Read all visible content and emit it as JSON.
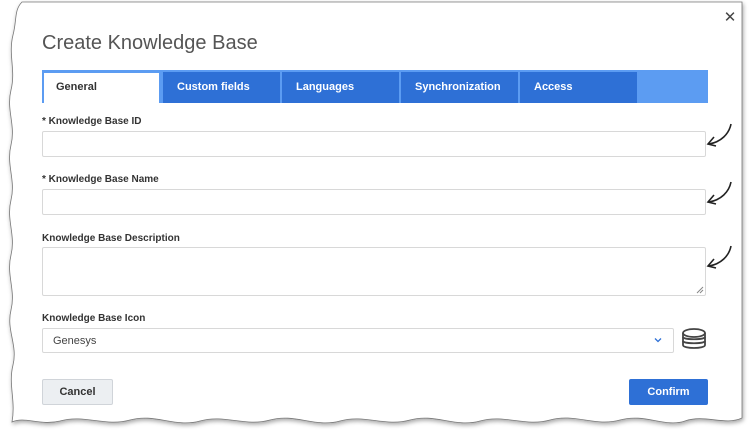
{
  "dialog": {
    "title": "Create Knowledge Base",
    "close_icon": "close-icon"
  },
  "tabs": [
    {
      "label": "General",
      "active": true
    },
    {
      "label": "Custom fields",
      "active": false
    },
    {
      "label": "Languages",
      "active": false
    },
    {
      "label": "Synchronization",
      "active": false
    },
    {
      "label": "Access",
      "active": false
    }
  ],
  "fields": {
    "kb_id": {
      "label": "* Knowledge Base ID",
      "value": ""
    },
    "kb_name": {
      "label": "* Knowledge Base Name",
      "value": ""
    },
    "kb_description": {
      "label": "Knowledge Base Description",
      "value": ""
    },
    "kb_icon": {
      "label": "Knowledge Base Icon",
      "value": "Genesys",
      "icon": "database-stack-icon"
    }
  },
  "buttons": {
    "cancel": "Cancel",
    "confirm": "Confirm"
  },
  "colors": {
    "tab_bar": "#5c9cf2",
    "tab": "#2e70d6",
    "primary_button": "#2e70d6"
  }
}
